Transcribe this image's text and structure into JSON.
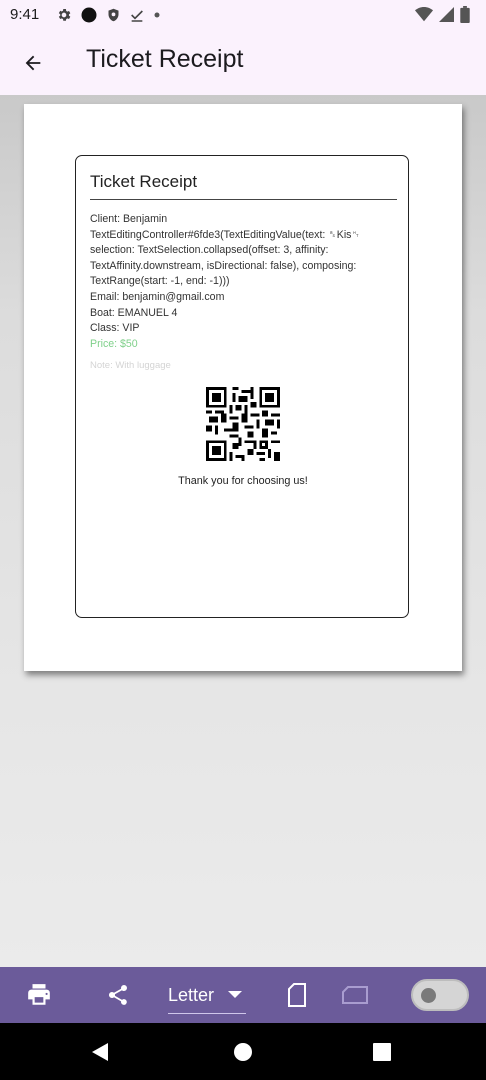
{
  "status_bar": {
    "time": "9:41",
    "left_icons": [
      "gear-icon",
      "circle-icon",
      "shield-icon",
      "check-download-icon",
      "dot-icon"
    ],
    "right_icons": [
      "wifi-icon",
      "signal-icon",
      "battery-icon"
    ]
  },
  "app_bar": {
    "back_icon": "arrow-left-icon",
    "title": "Ticket Receipt"
  },
  "receipt": {
    "title": "Ticket Receipt",
    "lines": [
      "Client: Benjamin",
      "TextEditingController#6fde3(TextEditingValue(text: ␈Kis␉",
      "selection: TextSelection.collapsed(offset: 3, affinity:",
      "TextAffinity.downstream, isDirectional: false), composing:",
      "TextRange(start: -1, end: -1)))",
      "Email: benjamin@gmail.com",
      "Boat: EMANUEL 4",
      "Class: VIP"
    ],
    "price": "Price: $50",
    "note": "Note: With luggage",
    "thanks": "Thank you for choosing us!",
    "qr_icon": "qr-code"
  },
  "toolbar": {
    "print_icon": "printer-icon",
    "share_icon": "share-icon",
    "paper_size": "Letter",
    "dropdown_icon": "caret-down-icon",
    "portrait_icon": "portrait-page-icon",
    "landscape_icon": "landscape-page-icon",
    "toggle_on": false
  },
  "nav_bar": {
    "back_icon": "triangle-back-icon",
    "home_icon": "circle-home-icon",
    "recents_icon": "square-recents-icon"
  },
  "colors": {
    "app_bar_bg": "#fbf2fd",
    "toolbar_bg": "#6b5b9a",
    "price_color": "#7fd08a"
  }
}
